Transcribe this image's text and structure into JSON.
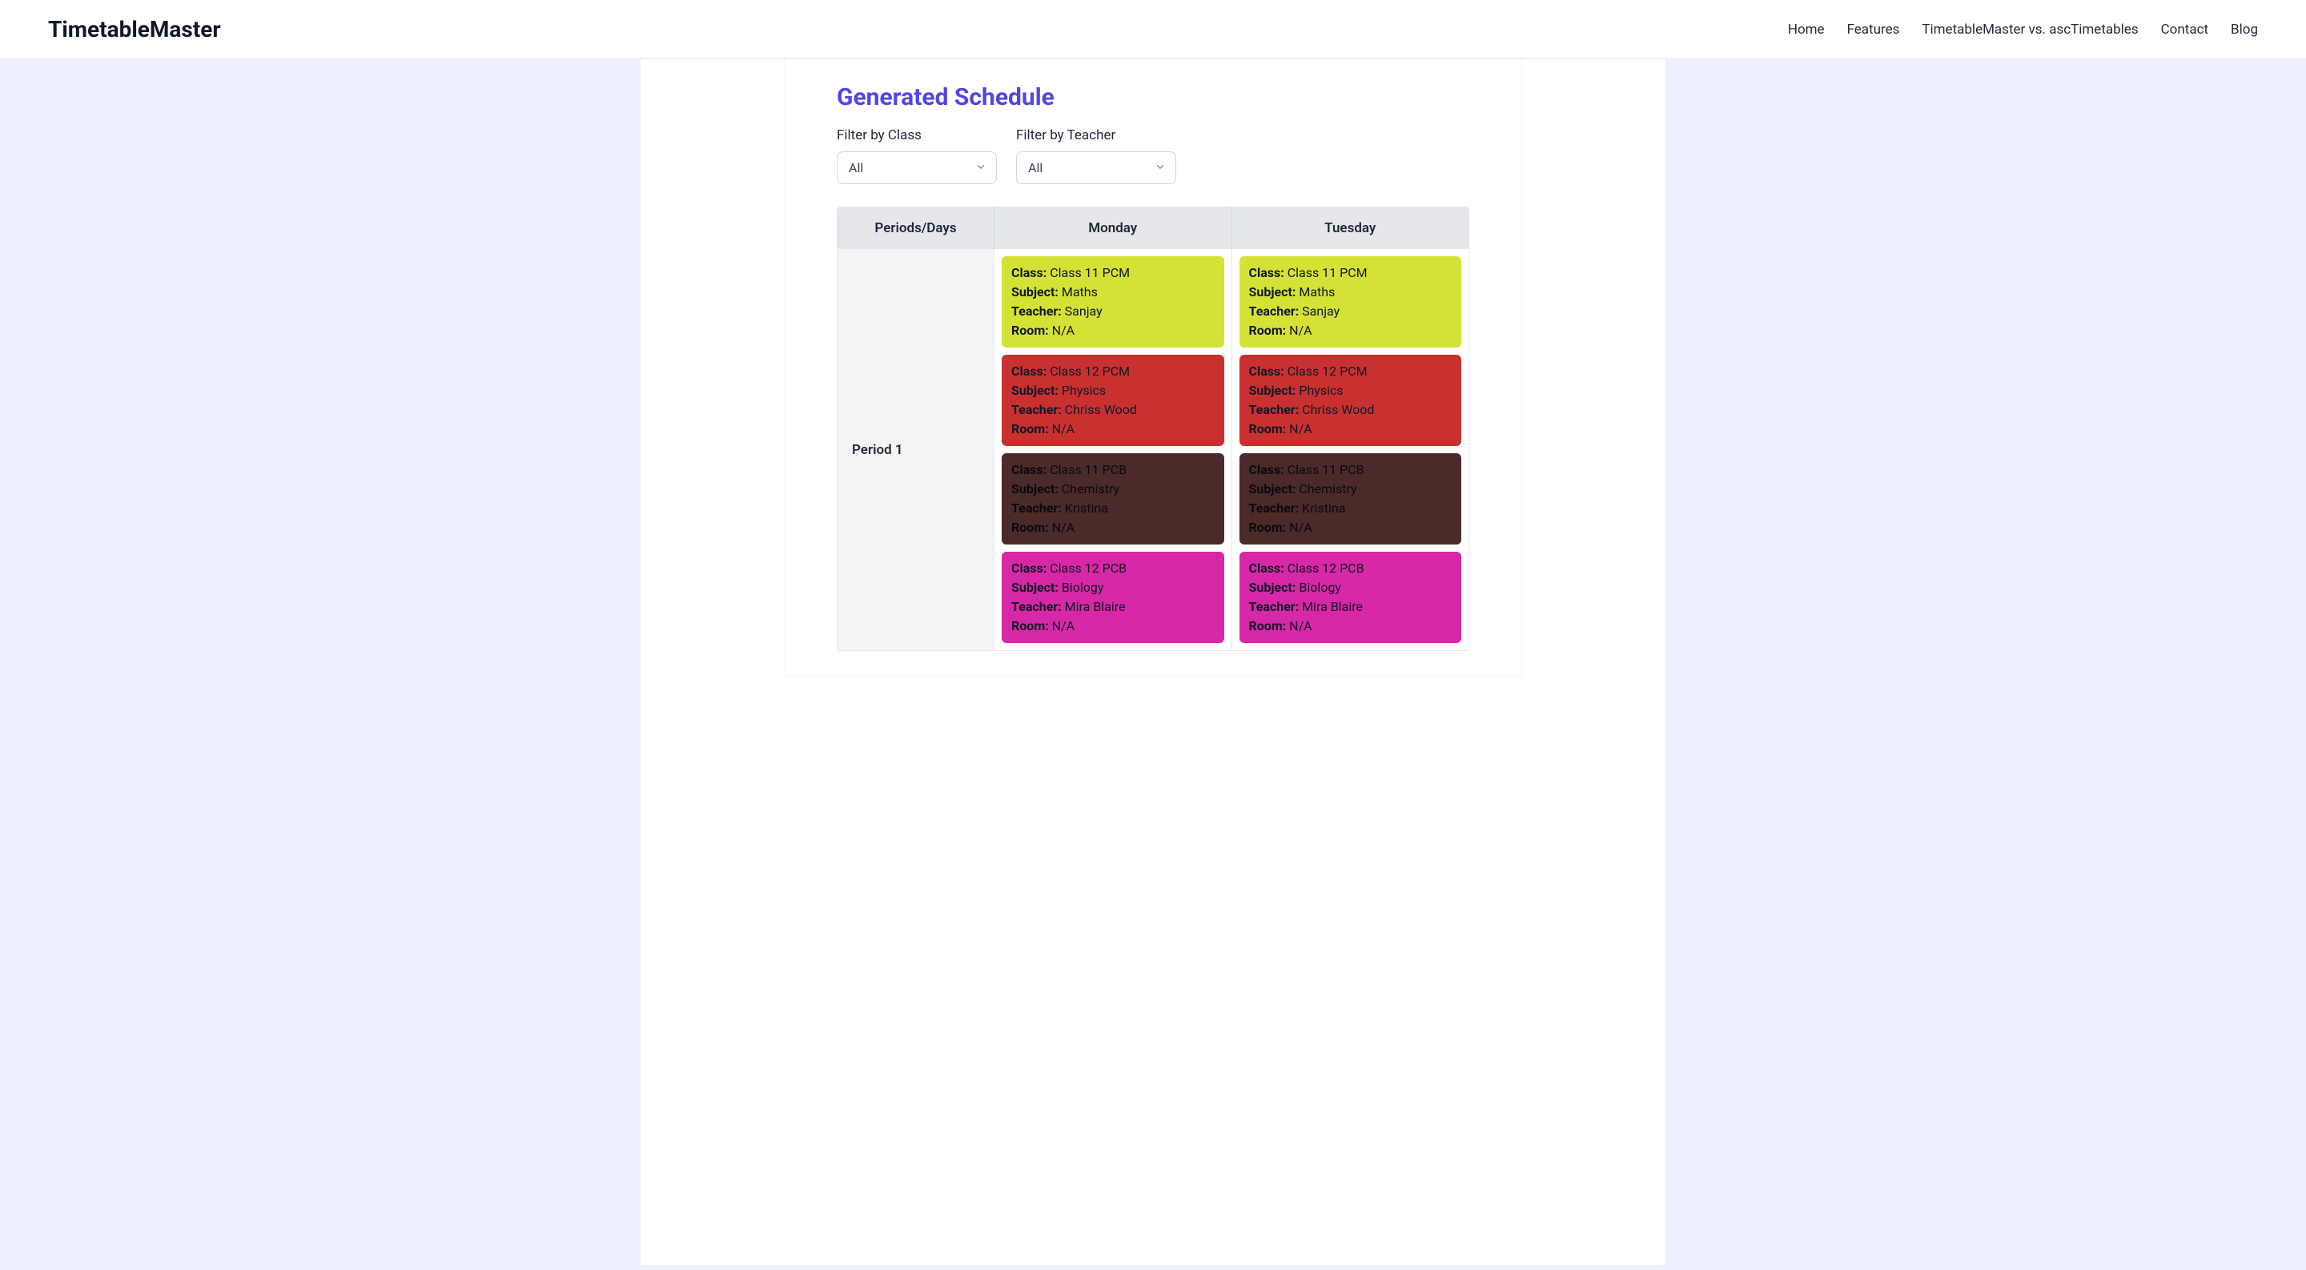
{
  "header": {
    "logo": "TimetableMaster",
    "nav": {
      "home": "Home",
      "features": "Features",
      "vs": "TimetableMaster vs. ascTimetables",
      "contact": "Contact",
      "blog": "Blog"
    }
  },
  "section": {
    "title": "Generated Schedule",
    "filters": {
      "class": {
        "label": "Filter by Class",
        "value": "All"
      },
      "teacher": {
        "label": "Filter by Teacher",
        "value": "All"
      }
    }
  },
  "table": {
    "headers": {
      "periods_days": "Periods/Days",
      "monday": "Monday",
      "tuesday": "Tuesday"
    },
    "rows": [
      {
        "period": "Period 1",
        "days": [
          [
            {
              "class": "Class 11 PCM",
              "subject": "Maths",
              "teacher": "Sanjay",
              "room": "N/A",
              "color": "yellow"
            },
            {
              "class": "Class 12 PCM",
              "subject": "Physics",
              "teacher": "Chriss Wood",
              "room": "N/A",
              "color": "red"
            },
            {
              "class": "Class 11 PCB",
              "subject": "Chemistry",
              "teacher": "Kristina",
              "room": "N/A",
              "color": "brown"
            },
            {
              "class": "Class 12 PCB",
              "subject": "Biology",
              "teacher": "Mira Blaire",
              "room": "N/A",
              "color": "pink"
            }
          ],
          [
            {
              "class": "Class 11 PCM",
              "subject": "Maths",
              "teacher": "Sanjay",
              "room": "N/A",
              "color": "yellow"
            },
            {
              "class": "Class 12 PCM",
              "subject": "Physics",
              "teacher": "Chriss Wood",
              "room": "N/A",
              "color": "red"
            },
            {
              "class": "Class 11 PCB",
              "subject": "Chemistry",
              "teacher": "Kristina",
              "room": "N/A",
              "color": "brown"
            },
            {
              "class": "Class 12 PCB",
              "subject": "Biology",
              "teacher": "Mira Blaire",
              "room": "N/A",
              "color": "pink"
            }
          ]
        ]
      }
    ]
  },
  "labels": {
    "class": "Class:",
    "subject": "Subject:",
    "teacher": "Teacher:",
    "room": "Room:"
  }
}
